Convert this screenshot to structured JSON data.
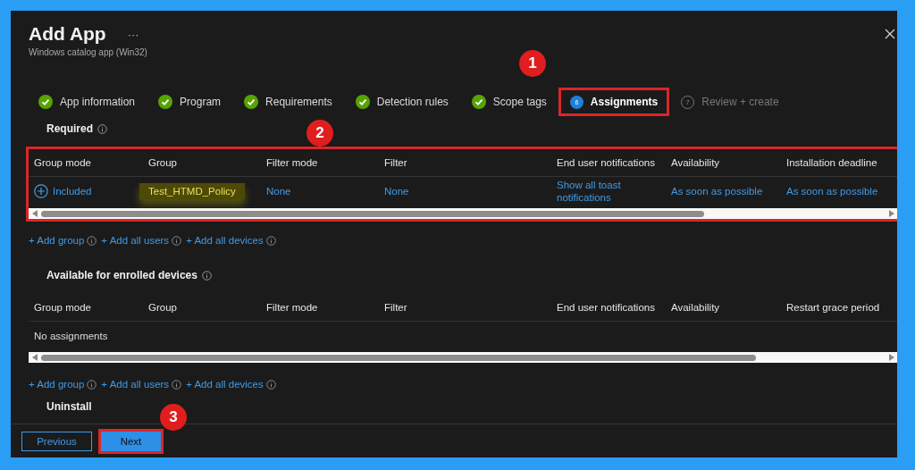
{
  "window": {
    "title": "Add App",
    "more": "···",
    "subtitle": "Windows catalog app (Win32)"
  },
  "steps": [
    {
      "label": "App information",
      "kind": "done",
      "highlighted": false
    },
    {
      "label": "Program",
      "kind": "done",
      "highlighted": false
    },
    {
      "label": "Requirements",
      "kind": "done",
      "highlighted": false
    },
    {
      "label": "Detection rules",
      "kind": "done",
      "highlighted": false
    },
    {
      "label": "Scope tags",
      "kind": "done",
      "highlighted": false
    },
    {
      "number": "6",
      "label": "Assignments",
      "kind": "current",
      "highlighted": true
    },
    {
      "number": "7",
      "label": "Review + create",
      "kind": "pending",
      "highlighted": false
    }
  ],
  "callouts": [
    {
      "number": "1"
    },
    {
      "number": "2"
    },
    {
      "number": "3"
    }
  ],
  "required": {
    "title": "Required",
    "highlighted": true,
    "columns": [
      "Group mode",
      "Group",
      "Filter mode",
      "Filter",
      "End user notifications",
      "Availability",
      "Installation deadline"
    ],
    "rows": [
      {
        "cells": [
          {
            "text": "Included",
            "kind": "mode"
          },
          {
            "text": "Test_HTMD_Policy",
            "kind": "group",
            "highlighted": true
          },
          {
            "text": "None",
            "kind": "link"
          },
          {
            "text": "None",
            "kind": "link"
          },
          {
            "text": "Show all toast notifications",
            "kind": "link"
          },
          {
            "text": "As soon as possible",
            "kind": "link"
          },
          {
            "text": "As soon as possible",
            "kind": "link"
          }
        ]
      }
    ],
    "actions": [
      "+ Add group",
      "+ Add all users",
      "+ Add all devices"
    ]
  },
  "available": {
    "title": "Available for enrolled devices",
    "columns": [
      "Group mode",
      "Group",
      "Filter mode",
      "Filter",
      "End user notifications",
      "Availability",
      "Restart grace period"
    ],
    "empty_text": "No assignments",
    "actions": [
      "+ Add group",
      "+ Add all users",
      "+ Add all devices"
    ]
  },
  "uninstall": {
    "title": "Uninstall"
  },
  "footer": {
    "buttons": [
      {
        "label": "Previous",
        "kind": "secondary",
        "highlighted": false
      },
      {
        "label": "Next",
        "kind": "primary",
        "highlighted": true
      }
    ]
  }
}
